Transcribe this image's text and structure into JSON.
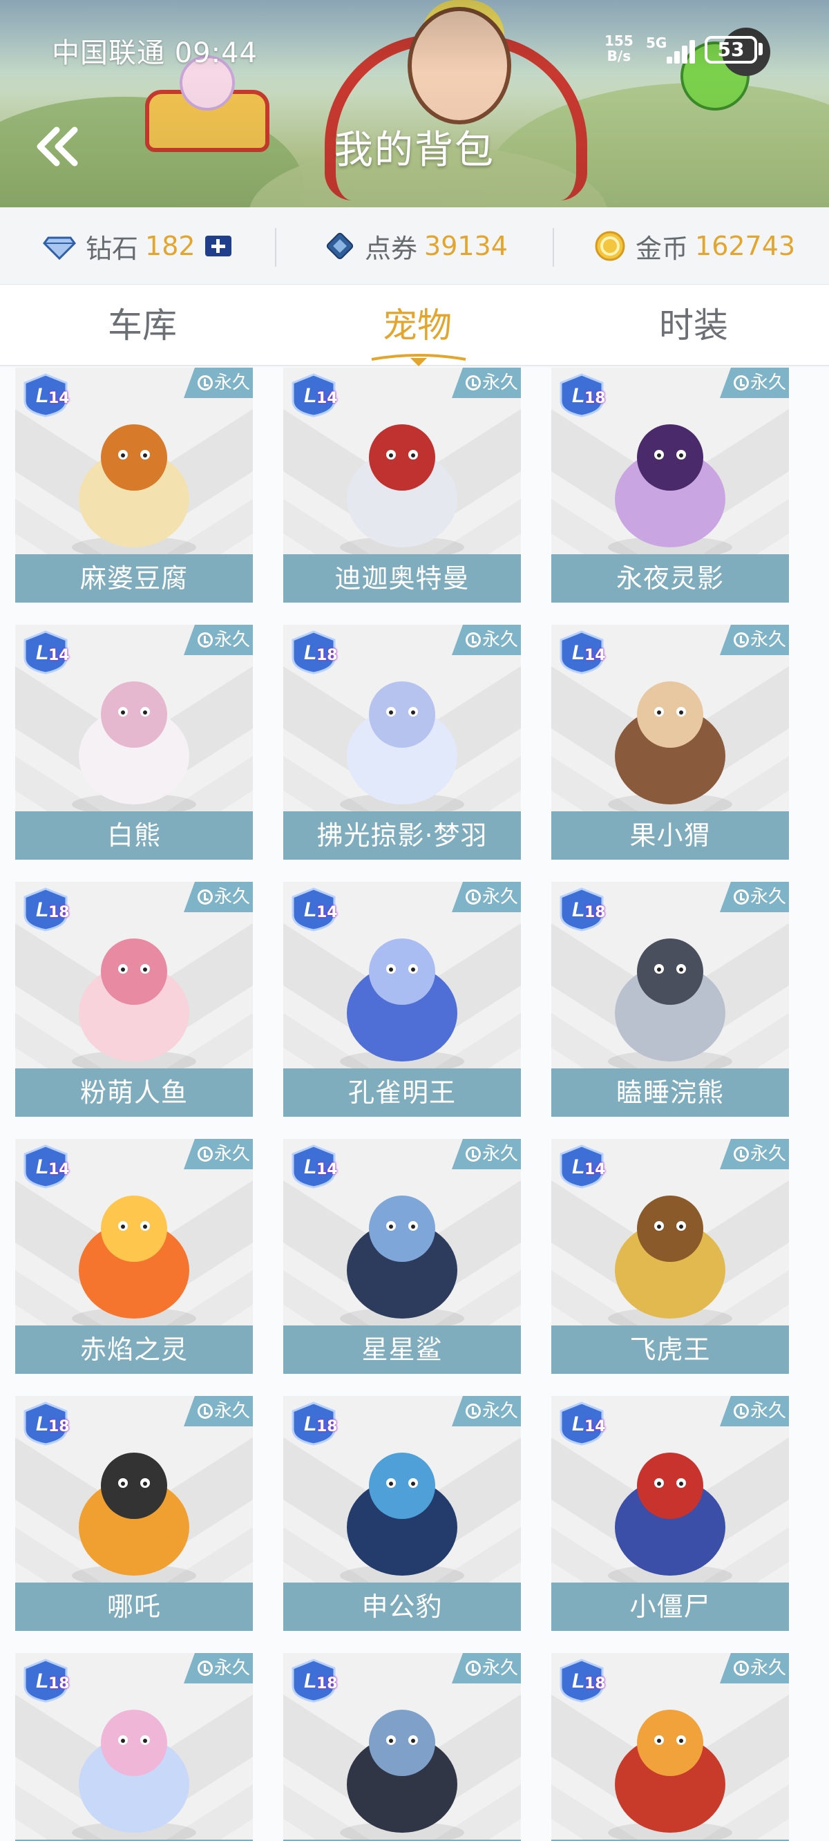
{
  "status_bar": {
    "carrier_time": "中国联通 09:44",
    "net_speed_value": "155",
    "net_speed_unit": "B/s",
    "net_type": "5G",
    "battery": "53"
  },
  "header": {
    "title": "我的背包",
    "back_icon": "double-chevron-left-icon"
  },
  "currencies": [
    {
      "icon": "diamond-icon",
      "label": "钻石",
      "value": "182",
      "has_add": true,
      "color": "#e4a52d"
    },
    {
      "icon": "coupon-icon",
      "label": "点券",
      "value": "39134",
      "color": "#e4a52d"
    },
    {
      "icon": "gold-coin-icon",
      "label": "金币",
      "value": "162743",
      "color": "#e4a52d"
    }
  ],
  "tabs": [
    {
      "label": "车库",
      "active": false
    },
    {
      "label": "宠物",
      "active": true
    },
    {
      "label": "时装",
      "active": false
    }
  ],
  "pets": [
    {
      "name": "麻婆豆腐",
      "level": "14",
      "duration": "永久"
    },
    {
      "name": "迪迦奥特曼",
      "level": "14",
      "duration": "永久"
    },
    {
      "name": "永夜灵影",
      "level": "18",
      "duration": "永久"
    },
    {
      "name": "白熊",
      "level": "14",
      "duration": "永久"
    },
    {
      "name": "拂光掠影·梦羽",
      "level": "18",
      "duration": "永久"
    },
    {
      "name": "果小猬",
      "level": "14",
      "duration": "永久"
    },
    {
      "name": "粉萌人鱼",
      "level": "18",
      "duration": "永久"
    },
    {
      "name": "孔雀明王",
      "level": "14",
      "duration": "永久"
    },
    {
      "name": "瞌睡浣熊",
      "level": "18",
      "duration": "永久"
    },
    {
      "name": "赤焰之灵",
      "level": "14",
      "duration": "永久"
    },
    {
      "name": "星星鲨",
      "level": "14",
      "duration": "永久"
    },
    {
      "name": "飞虎王",
      "level": "14",
      "duration": "永久"
    },
    {
      "name": "哪吒",
      "level": "18",
      "duration": "永久"
    },
    {
      "name": "申公豹",
      "level": "18",
      "duration": "永久"
    },
    {
      "name": "小僵尸",
      "level": "14",
      "duration": "永久"
    },
    {
      "name": "",
      "level": "18",
      "duration": "永久"
    },
    {
      "name": "",
      "level": "18",
      "duration": "永久"
    },
    {
      "name": "",
      "level": "18",
      "duration": "永久"
    }
  ],
  "colors": {
    "accent": "#e4a52d",
    "name_bar": "#7fadbd",
    "tag": "#7fb3c7",
    "tab_inactive": "#6c7075"
  }
}
